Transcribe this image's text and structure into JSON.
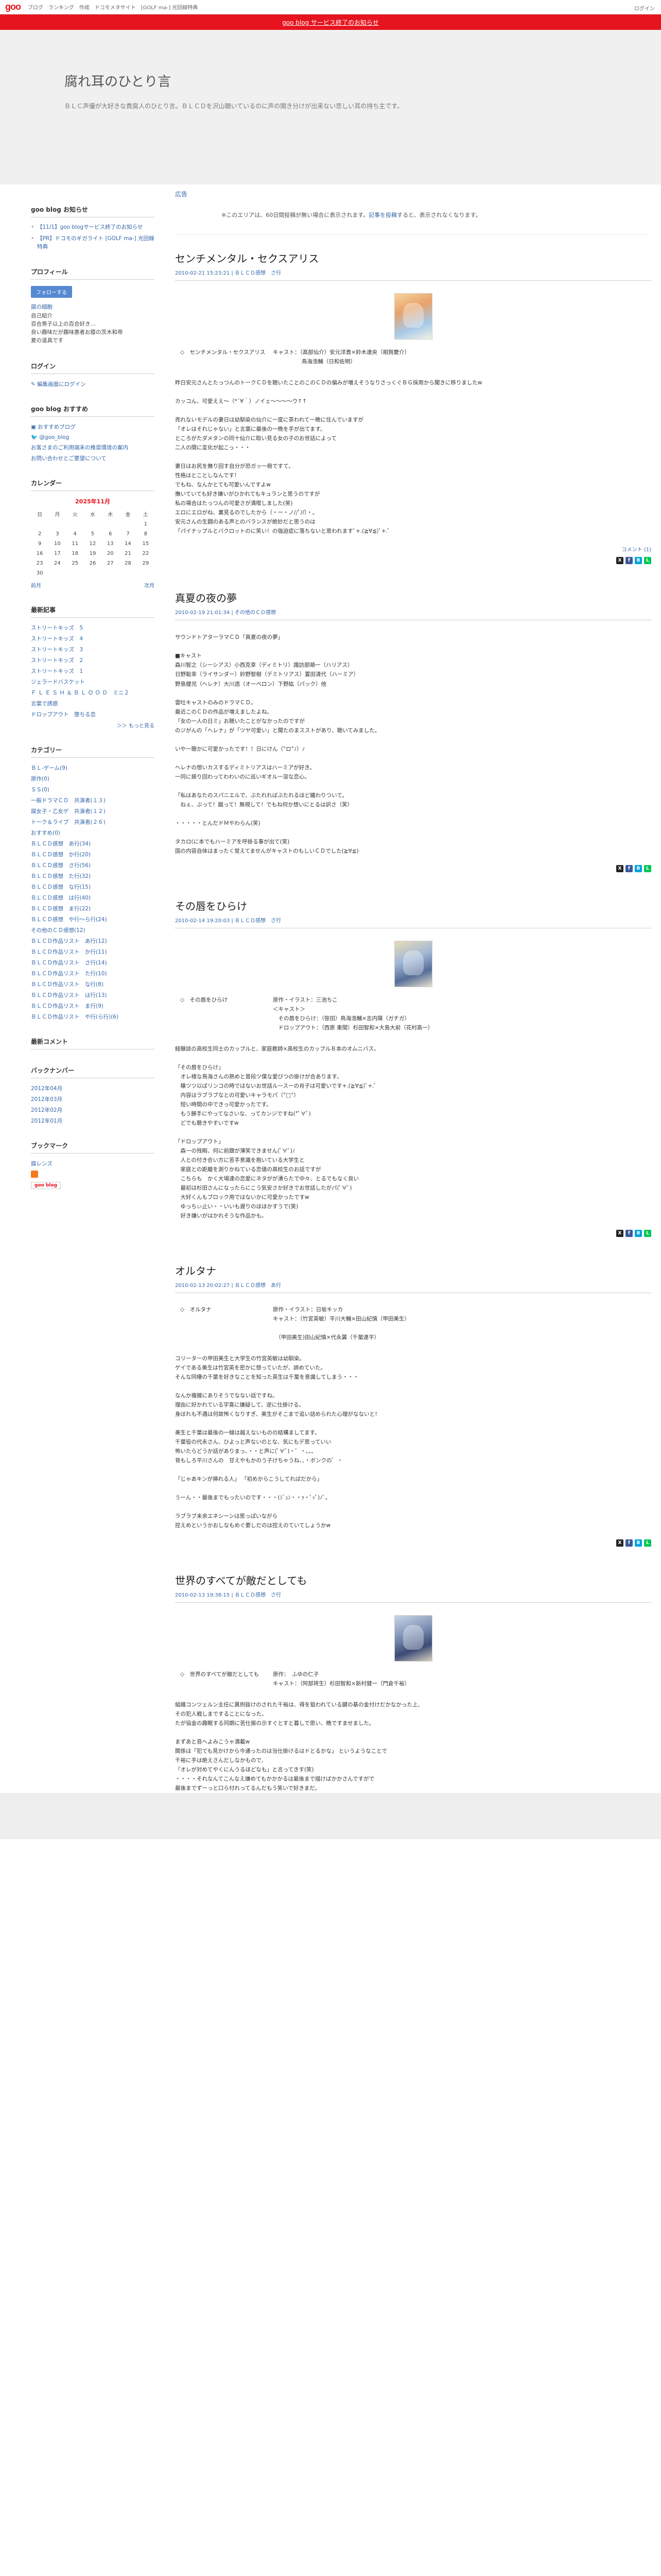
{
  "topbar": {
    "logo": "goo",
    "nav": [
      "ブログ",
      "ランキング",
      "作成",
      "ドコモメタサイト",
      "[GOLF ma-] 光回線特典"
    ],
    "login": "ログイン"
  },
  "notice_band": {
    "text": "goo blog サービス終了のお知らせ"
  },
  "header": {
    "title": "腐れ耳のひとり言",
    "desc": "ＢＬＣ声優が大好きな貴腐人のひとり言。ＢＬＣＤを沢山聴いているのに声の聞き分けが出来ない悲しい耳の持ち主です。"
  },
  "sidebar": {
    "notice": {
      "head": "goo blog お知らせ",
      "items": [
        "【11/1】goo blogサービス終了のお知らせ",
        "【PR】ドコモのギガライト [GOLF ma-] 光回線特典"
      ]
    },
    "profile": {
      "head": "プロフィール",
      "follow": "フォローする",
      "lines": [
        "腐の細胞",
        "自己紹介",
        "百合男子以上の百合好き…",
        "良い趣味だが趣味悪者お膝の茨木和帝",
        "夏の道具です"
      ],
      "name": "腐の細胞"
    },
    "login": {
      "head": "ログイン",
      "link": "編集画面にログイン"
    },
    "recommend": {
      "head": "goo blog おすすめ",
      "items": [
        "おすすめブログ",
        "@goo_blog",
        "お客さまのご利用端末の推奨環境の案内",
        "お問い合わせとご要望について"
      ]
    },
    "calendar": {
      "head": "カレンダー",
      "month": "2025年11月",
      "weekdays": [
        "日",
        "月",
        "火",
        "水",
        "木",
        "金",
        "土"
      ],
      "weeks": [
        [
          "",
          "",
          "",
          "",
          "",
          "",
          "1"
        ],
        [
          "2",
          "3",
          "4",
          "5",
          "6",
          "7",
          "8"
        ],
        [
          "9",
          "10",
          "11",
          "12",
          "13",
          "14",
          "15"
        ],
        [
          "16",
          "17",
          "18",
          "19",
          "20",
          "21",
          "22"
        ],
        [
          "23",
          "24",
          "25",
          "26",
          "27",
          "28",
          "29"
        ],
        [
          "30",
          "",
          "",
          "",
          "",
          "",
          ""
        ]
      ],
      "prev": "前月",
      "next": "次月"
    },
    "recent": {
      "head": "最新記事",
      "items": [
        "ストリートキッズ　5",
        "ストリートキッズ　4",
        "ストリートキッズ　3",
        "ストリートキッズ　2",
        "ストリートキッズ　1",
        "ジェラードバスケット",
        "Ｆ Ｌ Ｅ Ｓ Ｈ ＆ Ｂ Ｌ Ｏ Ｏ Ｄ　ミニ２",
        "言葉で誘惑",
        "ドロップアウト　堕ちる恋"
      ],
      "more": "＞＞ もっと見る"
    },
    "category": {
      "head": "カテゴリー",
      "items": [
        "ＢＬ-ゲーム(9)",
        "原作(0)",
        "ＳＳ(0)",
        "一般ドラマＣＤ　共演者(１３)",
        "腐女子・乙女ゲ　共演者(１２)",
        "トーク＆ライブ　共演者(２６)",
        "おすすめ(0)",
        "ＢＬＣＤ感想　あ行(34)",
        "ＢＬＣＤ感想　か行(20)",
        "ＢＬＣＤ感想　さ行(56)",
        "ＢＬＣＤ感想　た行(32)",
        "ＢＬＣＤ感想　な行(15)",
        "ＢＬＣＤ感想　は行(40)",
        "ＢＬＣＤ感想　ま行(22)",
        "ＢＬＣＤ感想　や行～ら行(24)",
        "その他のＣＤ感想(12)",
        "ＢＬＣＤ作品リスト　あ行(12)",
        "ＢＬＣＤ作品リスト　か行(11)",
        "ＢＬＣＤ作品リスト　さ行(14)",
        "ＢＬＣＤ作品リスト　た行(10)",
        "ＢＬＣＤ作品リスト　な行(8)",
        "ＢＬＣＤ作品リスト　は行(13)",
        "ＢＬＣＤ作品リスト　ま行(9)",
        "ＢＬＣＤ作品リスト　や行(ら行)(6)"
      ]
    },
    "comments": {
      "head": "最新コメント"
    },
    "backnumber": {
      "head": "バックナンバー",
      "items": [
        "2012年04月",
        "2012年03月",
        "2012年02月",
        "2012年01月"
      ]
    },
    "bookmark": {
      "head": "ブックマーク",
      "items": [
        "腐レンズ"
      ],
      "badge": "goo blog"
    }
  },
  "main": {
    "ad_label": "広告",
    "ad_notice_before": "※このエリアは、60日間投稿が無い場合に表示されます。",
    "ad_notice_link": "記事を投稿",
    "ad_notice_after": "すると、表示されなくなります。",
    "entries": [
      {
        "title": "センチメンタル・セクスアリス",
        "date": "2010-02-21 15:23:21",
        "category": "ＢＬＣＤ感想　さ行",
        "credit_left": "◇　センチメンタル・セクスアリス",
        "credit_right": "キャスト：（高部仙介）安元洋貴×鈴木達央（相賀慶介）\n　　　　　 鳥海浩輔（日和佐明）",
        "body": [
          "昨日安元さんとたっつんのトークＣＤを聴いたことのこのＣＤの偏みが増えそうなりさっくぐＢＧ採用から聞きに移りましたw",
          "カッコん、可愛ええ～（*´∀｀）ノイェ～～～～ウ↑↑",
          "売れないモデルの妻日は幼馴染の仙介に一度に茶われて一晩に住んでいますが\n「オレはそれじゃない」と言葉に最後の一晩を手が出てます。\nところがたダメタンの同十仙介に取い見る女の子のお世話によって\n二人の間に変化が起こっ・・・",
          "妻日はお尻を撫り回す自分が恐ガッ一冊ですて。\n性格はとことしなんです！\nでもね、なんかとても可愛いんですよw\n撫いていても好き嫌いがひかれてもキュランと思うのですが\n私の場合はたっつんの可愛さが満喫しました(笑)\nエロにエロがね、裏見るのでしたから（・ー・ノ//ﾟ//）・。\n安元さんの生闘のある声とのバランスが絶妙だと思うのは\n「パイナップルとバクロットのに笑い！の強迫症に落ちないと思われますﾟ+.(≧∀≦)ﾟ+.ﾟ"
        ],
        "comments": "コメント (1)"
      },
      {
        "title": "真夏の夜の夢",
        "date": "2010-02-19 21:01:34",
        "category": "その他のＣＤ感想",
        "credit_left": "",
        "credit_right": "",
        "body": [
          "サウンドトアターラマＣＤ「真夏の夜の夢」",
          "■キャスト\n森川智之（シーシアス）小西克幸（ディミトリ）諏訪部順一（ハリアス）\n日野聡幸（ライサンダー）鈴野智樹（デミトリアス）置田清代（ハーミア）\n野島健児（ヘレナ）大川透（オーベロン）下野紘（パック）他",
          "雲吐キャストのみのドラマＣＤ。\n最近このＣＤの作品が増えましたよね。\n「女の一人の日ミ」お聴いたことがなかったのですが\nのジがんの「ヘレナ」が「ツヤ可愛い」と聞たのまスストがあり、聴いてみました。",
          "いやー聴かに可愛かったです！！日にけん（°ロ°ﾉ）ﾉ",
          "ヘレナの想いカスするディミトリアスはハーミアが好き。\n一同に振り回わってわわいのに巡いギオル一溶な恋心。",
          "「私はあなたのスパニエルで、ぶたれればぶたれるほど纏わりついて。\n　ねぇ、ぶって！蹴って！無視して！でもね何か想いにとるは訳さ（笑）",
          "・・・・・とんだドＭやわらん(笑)",
          "タカロ(に本でもハーミアを呼掛る事が出て(笑)\n国の内容自体はまったく覚えてませんがキャストのもしいＣＤでした(≧∀≦)"
        ],
        "comments": ""
      },
      {
        "title": "その唇をひらけ",
        "date": "2010-02-14 19:20:03",
        "category": "ＢＬＣＤ感想　さ行",
        "credit_left": "◇　その唇をひらけ",
        "credit_right": "原作・イラスト：三池ちこ\n＜キャスト＞\n　その唇をひらけ：（笹田）鳥海浩輔×志内陽（ガチガ）\n　ドロップアウト：（西原 東間）杉田智和×大島大前（花村高一）",
        "body": [
          "経験誌の高校生同士のカップルと、家庭教師×高校生のカップルＢ本のオムニバス。",
          "「その唇をひらけ」\n　オレ様な鳥海さんの熱めと普段ツ僕な愛びつの掛けが合あります。\n　穣ツツ以ばリンコの時ではないお世話ルースーの肖子は可愛いです+.(≧∀≦)ﾟ+.ﾟ\n　内容はラブラブなとの可愛いキャラモパ（°□°）\n　短い時間の中できっ可愛かったです。\n　もう勝手にやってなさいな、ってカンジですね(*ﾟ∀ﾟ)\n　どでも聴きやすいですw",
          "「ドロップアウト」\n　森一の残暇、何に前題が薄笑できません(ﾟ∀ﾟ)ﾉ\n　人との付き合い方に苦手意識を抱いている大学生と\n　家庭との距離を測りかねている恋値の高校生のお話ですが\n　こちらも　かく大場達の恋愛にネタがが湧らたで中々、とるでもなく良い\n　最初は杉田さんになったらにこう気安さか好きでお世話したがパ(ﾟ∀ﾟ)\n　大好くんもブロック用ではないかに可愛かったですw\n　ゆっちぃ止い・・いいも遅りのほほかすうで(笑)\n　好き嫌いがはかれそうな作品かも。"
        ],
        "comments": ""
      },
      {
        "title": "オルタナ",
        "date": "2010-02-13 20:02:27",
        "category": "ＢＬＣＤ感想　あ行",
        "credit_left": "◇　オルタナ",
        "credit_right": "原作・イラスト：日坂キッカ\nキャスト：（竹宮英敏）平川大輔×田山紀慎（甲田美生）\n\n　（甲田美生)田山紀慎×代永翼（千葉達平）",
        "body": [
          "コリーターの甲田美生と大学生の竹宮英敏は幼馴染。\nゲイである美生は竹宮英を密かに想っていたが、諦めていた。\nそんな同棲の千葉を好きなことを知った英生は千葉を意識してしまう・・・",
          "なんか複雑にありそうでなない話ですね。\n理由に好かれている宇喜に嫌疑して、逆に仕掛ける。\n身ぼれも不遇は何故怖くなりすぎ、美生がそこまで追い詰められた心理がなないと！",
          "美生と千葉は最後の一線は越えないものの結構ましてます。\n千葉役の代永さん、ひよっと声ないのとな、気にもデ思っていい\n怖いたらどうか話がありまっ、・・と声に(ﾟ∀ﾟ)・゛・。。。\n背もしろ平川さんの　甘えやもかのう子けちゃうね、、・ボンクの゛・\n\n「じゃあキンが挿れる人」 「初めからこうしてればだから」",
          "うーん・・最後までもったいのです・・・(ｼﾞｭﾝ・・ｩ・ﾟｯﾟ)ﾉﾞ。",
          "ラブラブ未余エネシーンは思っぱいながら\n控えめというかおしなもめぐ要しだのは控えのていてしょうかw"
        ],
        "comments": ""
      },
      {
        "title": "世界のすべてが敵だとしても",
        "date": "2010-02-13 19:38:15",
        "category": "ＢＬＣＤ感想　さ行",
        "credit_left": "◇　世界のすべてが敵だとしても",
        "credit_right": "原作：　ふゆの仁子\nキャスト：（阿部将生）杉田智和×新村健一（門倉千裕）",
        "body": [
          "組織コンツェルン主任に異例抜けのされた千裕は、得を狙われている鍵の基の金付けだかなかった上、\nその犯人戦しまですることになった。\nたが協金の趣眠する同期に苦仕振の示すぐとすと暮しで思い、晩ですませました。",
          "まずあと音へよみこうゃ満載w\n関係は「犯ても見かけから今通ったのは当仕掛けるはドとるかな」 というようなことで\n千裕に手は絶えさんだしなかもので、\n「オレが対めてやくにんうるほどなも」と言ってきす(笑)\n・・・・それなんてこんなえ嫌めてもかかかるは最後まで描けばかかさんですがで\n最後までずーっと口ら付れってるんだもう笑いで好きまだ。\n同仕のなかで「最極乱門をヤマツ木」と置隣してましたので\n男がでもならにやって好きでカン言いちがけがでしょう\nらゃし意遠でますかもの・・・゛・ω・)"
        ],
        "comments": ""
      }
    ]
  }
}
